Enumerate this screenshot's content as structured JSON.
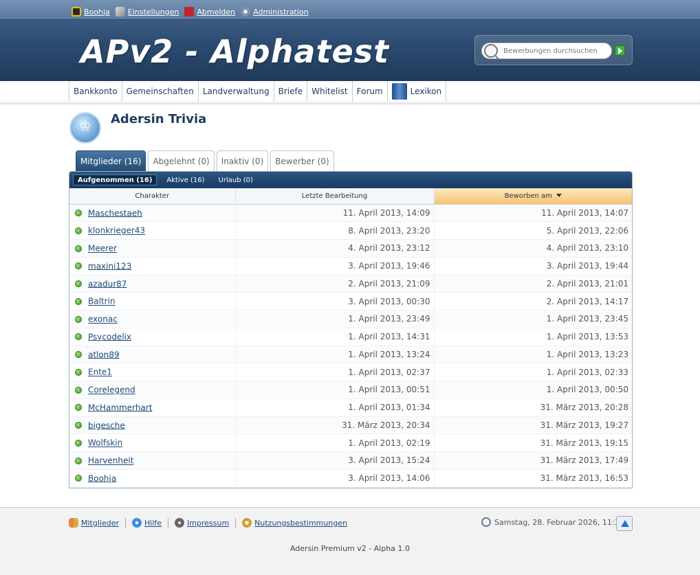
{
  "userbar": {
    "user": "Boohja",
    "settings": "Einstellungen",
    "logout": "Abmelden",
    "admin": "Administration"
  },
  "header": {
    "logo": "APv2 - Alphatest",
    "search_placeholder": "Bewerbungen durchsuchen"
  },
  "nav": {
    "items": [
      "Bankkonto",
      "Gemeinschaften",
      "Landverwaltung",
      "Briefe",
      "Whitelist",
      "Forum",
      "Lexikon"
    ]
  },
  "page": {
    "title": "Adersin Trivia"
  },
  "tabs": [
    "Mitglieder (16)",
    "Abgelehnt (0)",
    "Inaktiv (0)",
    "Bewerber (0)"
  ],
  "subtabs": [
    "Aufgenommen (16)",
    "Aktive (16)",
    "Urlaub (0)"
  ],
  "table": {
    "headers": [
      "Charakter",
      "Letzte Bearbeitung",
      "Beworben am"
    ],
    "rows": [
      [
        "Maschestaeh",
        "11. April 2013, 14:09",
        "11. April 2013, 14:07"
      ],
      [
        "klonkrieger43",
        "8. April 2013, 23:20",
        "5. April 2013, 22:06"
      ],
      [
        "Meerer",
        "4. April 2013, 23:12",
        "4. April 2013, 23:10"
      ],
      [
        "maxini123",
        "3. April 2013, 19:46",
        "3. April 2013, 19:44"
      ],
      [
        "azadur87",
        "2. April 2013, 21:09",
        "2. April 2013, 21:01"
      ],
      [
        "Baltrin",
        "3. April 2013, 00:30",
        "2. April 2013, 14:17"
      ],
      [
        "exonac",
        "1. April 2013, 23:49",
        "1. April 2013, 23:45"
      ],
      [
        "Psycodelix",
        "1. April 2013, 14:31",
        "1. April 2013, 13:53"
      ],
      [
        "atlon89",
        "1. April 2013, 13:24",
        "1. April 2013, 13:23"
      ],
      [
        "Ente1",
        "1. April 2013, 02:37",
        "1. April 2013, 02:33"
      ],
      [
        "Corelegend",
        "1. April 2013, 00:51",
        "1. April 2013, 00:50"
      ],
      [
        "McHammerhart",
        "1. April 2013, 01:34",
        "31. März 2013, 20:28"
      ],
      [
        "bigesche",
        "31. März 2013, 20:34",
        "31. März 2013, 19:27"
      ],
      [
        "Wolfskin",
        "1. April 2013, 02:19",
        "31. März 2013, 19:15"
      ],
      [
        "Harvenheit",
        "3. April 2013, 15:24",
        "31. März 2013, 17:49"
      ],
      [
        "Boohja",
        "3. April 2013, 14:06",
        "31. März 2013, 16:53"
      ]
    ]
  },
  "footer": {
    "links": [
      "Mitglieder",
      "Hilfe",
      "Impressum",
      "Nutzungsbestimmungen"
    ],
    "datetime": "Samstag, 28. Februar 2026, 11:35",
    "copyright": "Adersin Premium v2 - Alpha 1.0"
  }
}
